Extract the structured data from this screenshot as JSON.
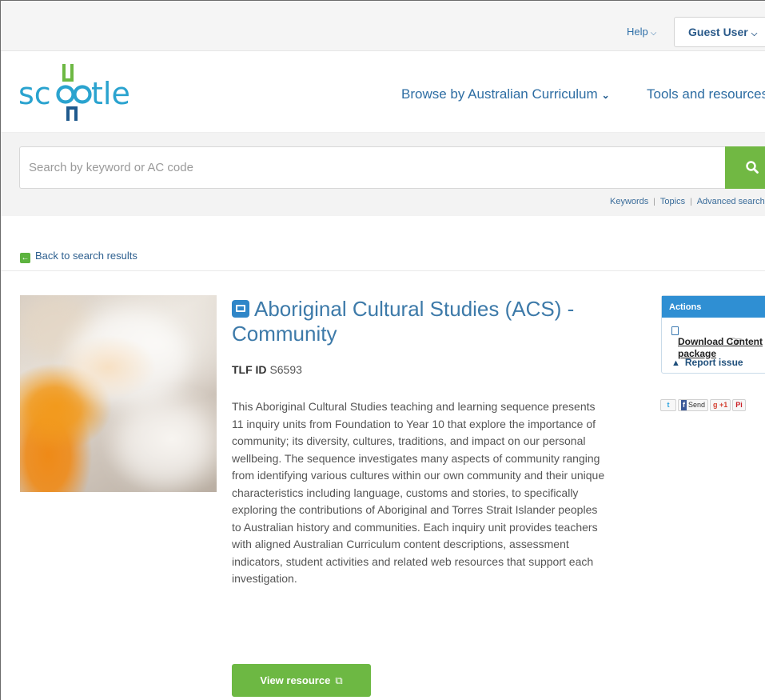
{
  "topbar": {
    "help_label": "Help",
    "user_label": "Guest User"
  },
  "header": {
    "logo_text": "scootle",
    "nav": [
      {
        "label": "Browse by Australian Curriculum"
      },
      {
        "label": "Tools and resources"
      }
    ]
  },
  "search": {
    "placeholder": "Search by keyword or AC code",
    "links": [
      "Keywords",
      "Topics",
      "Advanced search"
    ]
  },
  "back_link": "Back to search results",
  "resource": {
    "title": "Aboriginal Cultural Studies (ACS) - Community",
    "tlf_label": "TLF ID",
    "tlf_value": "S6593",
    "description": "This Aboriginal Cultural Studies teaching and learning sequence presents 11 inquiry units from Foundation to Year 10 that explore the importance of community; its diversity, cultures, traditions, and impact on our personal wellbeing. The sequence investigates many aspects of community ranging from identifying various cultures within our own community and their unique characteristics including language, customs and stories, to specifically exploring the contributions of Aboriginal and Torres Strait Islander peoples to Australian history and communities. Each inquiry unit provides teachers with aligned Australian Curriculum content descriptions, assessment indicators, student activities and related web resources that support each investigation.",
    "view_button": "View resource"
  },
  "actions": {
    "heading": "Actions",
    "download_label": "Download Content package",
    "report_label": "Report issue"
  },
  "social": {
    "twitter": "t",
    "facebook_f": "f",
    "facebook_send": "Send",
    "gplus": "g +1",
    "pinterest": "Pi"
  },
  "colors": {
    "brand_green": "#6db843",
    "brand_blue": "#3d7aa9",
    "actions_header": "#2f8fd3"
  }
}
